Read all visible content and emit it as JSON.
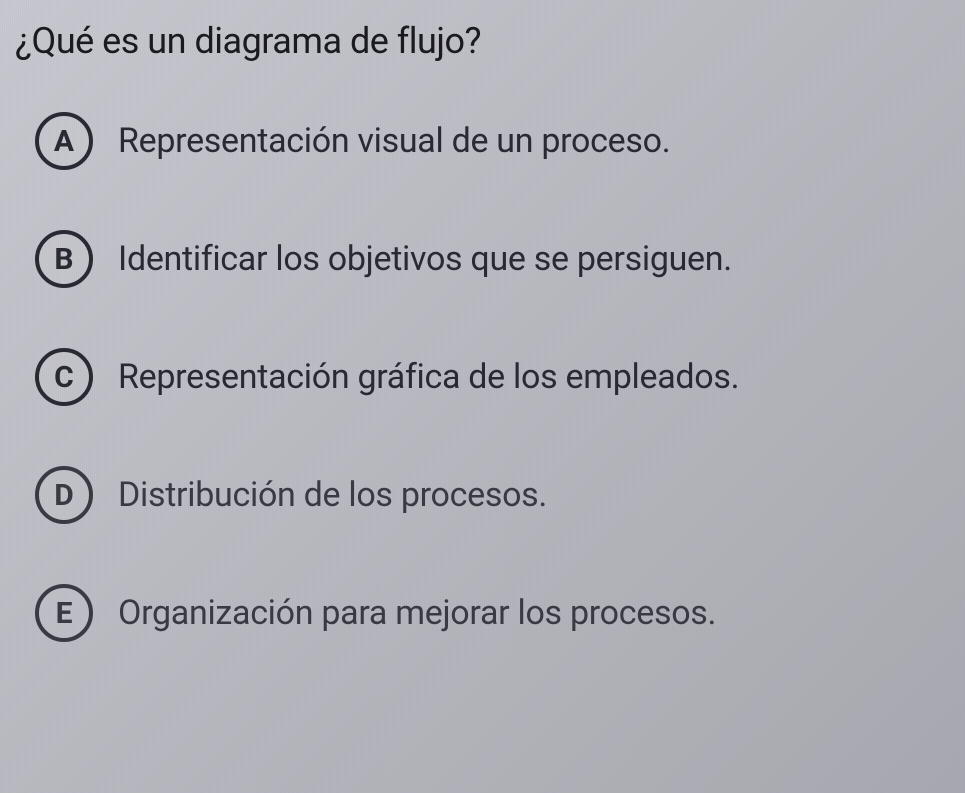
{
  "question": {
    "text": "¿Qué es un diagrama de flujo?"
  },
  "options": [
    {
      "letter": "A",
      "text": "Representación visual de un proceso."
    },
    {
      "letter": "B",
      "text": "Identificar los objetivos que se persiguen."
    },
    {
      "letter": "C",
      "text": "Representación gráfica de los empleados."
    },
    {
      "letter": "D",
      "text": "Distribución de los procesos."
    },
    {
      "letter": "E",
      "text": "Organización para mejorar los procesos."
    }
  ]
}
